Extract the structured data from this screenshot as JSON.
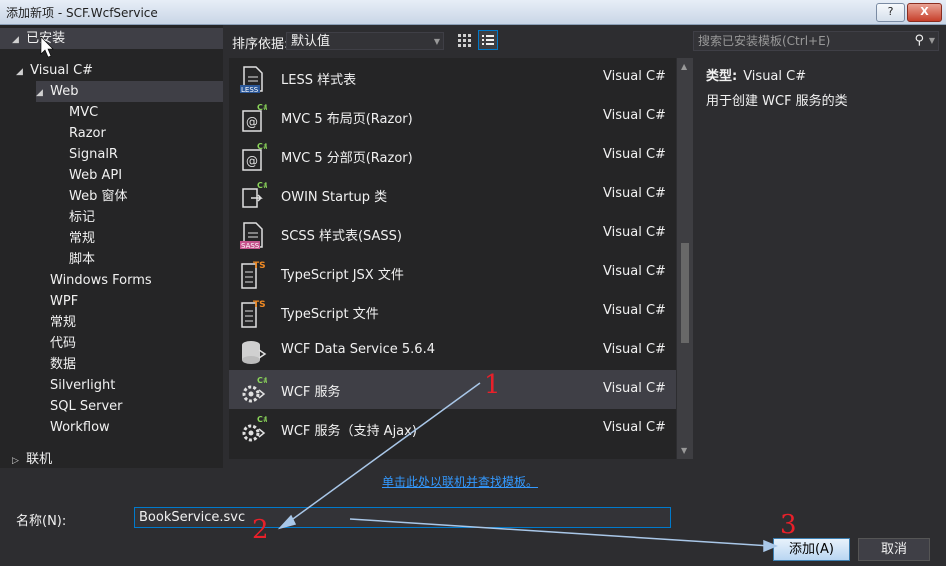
{
  "window": {
    "title": "添加新项 - SCF.WcfService",
    "help": "?",
    "close": "X"
  },
  "tree": {
    "installed": "已安装",
    "visual_csharp": "Visual C#",
    "web": "Web",
    "web_children": [
      "MVC",
      "Razor",
      "SignalR",
      "Web API",
      "Web 窗体",
      "标记",
      "常规",
      "脚本"
    ],
    "others": [
      "Windows Forms",
      "WPF",
      "常规",
      "代码",
      "数据",
      "Silverlight",
      "SQL Server",
      "Workflow"
    ],
    "online": "联机"
  },
  "toolbar": {
    "sort_label": "排序依据:",
    "sort_value": "默认值",
    "search_placeholder": "搜索已安装模板(Ctrl+E)"
  },
  "templates": [
    {
      "name": "LESS 样式表",
      "lang": "Visual C#",
      "icon": "less-file-icon"
    },
    {
      "name": "MVC 5 布局页(Razor)",
      "lang": "Visual C#",
      "icon": "razor-file-icon"
    },
    {
      "name": "MVC 5 分部页(Razor)",
      "lang": "Visual C#",
      "icon": "razor-file-icon"
    },
    {
      "name": "OWIN Startup 类",
      "lang": "Visual C#",
      "icon": "owin-class-icon"
    },
    {
      "name": "SCSS 样式表(SASS)",
      "lang": "Visual C#",
      "icon": "sass-file-icon"
    },
    {
      "name": "TypeScript JSX 文件",
      "lang": "Visual C#",
      "icon": "typescript-file-icon"
    },
    {
      "name": "TypeScript 文件",
      "lang": "Visual C#",
      "icon": "typescript-file-icon"
    },
    {
      "name": "WCF Data Service 5.6.4",
      "lang": "Visual C#",
      "icon": "data-service-icon"
    },
    {
      "name": "WCF 服务",
      "lang": "Visual C#",
      "icon": "wcf-service-icon",
      "selected": true
    },
    {
      "name": "WCF 服务（支持 Ajax)",
      "lang": "Visual C#",
      "icon": "wcf-service-icon"
    }
  ],
  "details": {
    "type_label": "类型:",
    "type_value": "Visual C#",
    "description": "用于创建 WCF 服务的类"
  },
  "online_link": "单击此处以联机并查找模板。",
  "name_field": {
    "label": "名称(N):",
    "value": "BookService.svc"
  },
  "buttons": {
    "add": "添加(A)",
    "cancel": "取消"
  },
  "annotations": [
    "1",
    "2",
    "3"
  ],
  "colors": {
    "accent": "#007acc",
    "annotation": "#e8202a",
    "link": "#3399ff"
  }
}
